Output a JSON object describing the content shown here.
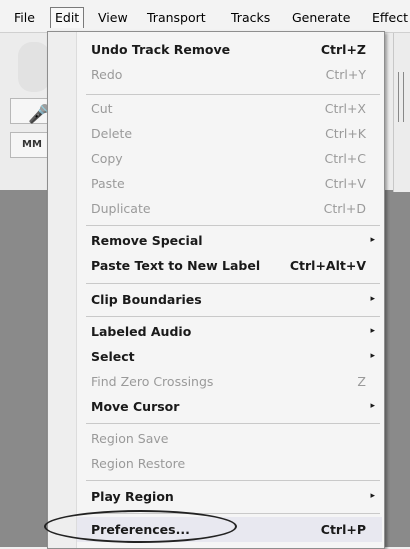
{
  "menubar": {
    "items": [
      {
        "label": "File"
      },
      {
        "label": "Edit"
      },
      {
        "label": "View"
      },
      {
        "label": "Transport"
      },
      {
        "label": "Tracks"
      },
      {
        "label": "Generate"
      },
      {
        "label": "Effect"
      }
    ]
  },
  "toolbar": {
    "mm": "MM"
  },
  "edit_menu": {
    "items": [
      {
        "label": "Undo Track Remove",
        "shortcut": "Ctrl+Z",
        "enabled": true
      },
      {
        "label": "Redo",
        "shortcut": "Ctrl+Y",
        "enabled": false
      },
      {
        "label": "Cut",
        "shortcut": "Ctrl+X",
        "enabled": false
      },
      {
        "label": "Delete",
        "shortcut": "Ctrl+K",
        "enabled": false
      },
      {
        "label": "Copy",
        "shortcut": "Ctrl+C",
        "enabled": false
      },
      {
        "label": "Paste",
        "shortcut": "Ctrl+V",
        "enabled": false
      },
      {
        "label": "Duplicate",
        "shortcut": "Ctrl+D",
        "enabled": false
      },
      {
        "label": "Remove Special",
        "submenu": true,
        "enabled": true
      },
      {
        "label": "Paste Text to New Label",
        "shortcut": "Ctrl+Alt+V",
        "enabled": true
      },
      {
        "label": "Clip Boundaries",
        "submenu": true,
        "enabled": true
      },
      {
        "label": "Labeled Audio",
        "submenu": true,
        "enabled": true
      },
      {
        "label": "Select",
        "submenu": true,
        "enabled": true
      },
      {
        "label": "Find Zero Crossings",
        "shortcut": "Z",
        "enabled": false
      },
      {
        "label": "Move Cursor",
        "submenu": true,
        "enabled": true
      },
      {
        "label": "Region Save",
        "enabled": false
      },
      {
        "label": "Region Restore",
        "enabled": false
      },
      {
        "label": "Play Region",
        "submenu": true,
        "enabled": true
      },
      {
        "label": "Preferences...",
        "shortcut": "Ctrl+P",
        "enabled": true,
        "highlighted": true
      }
    ]
  },
  "submenu_arrow": "▸",
  "annotation_color": "#222222"
}
